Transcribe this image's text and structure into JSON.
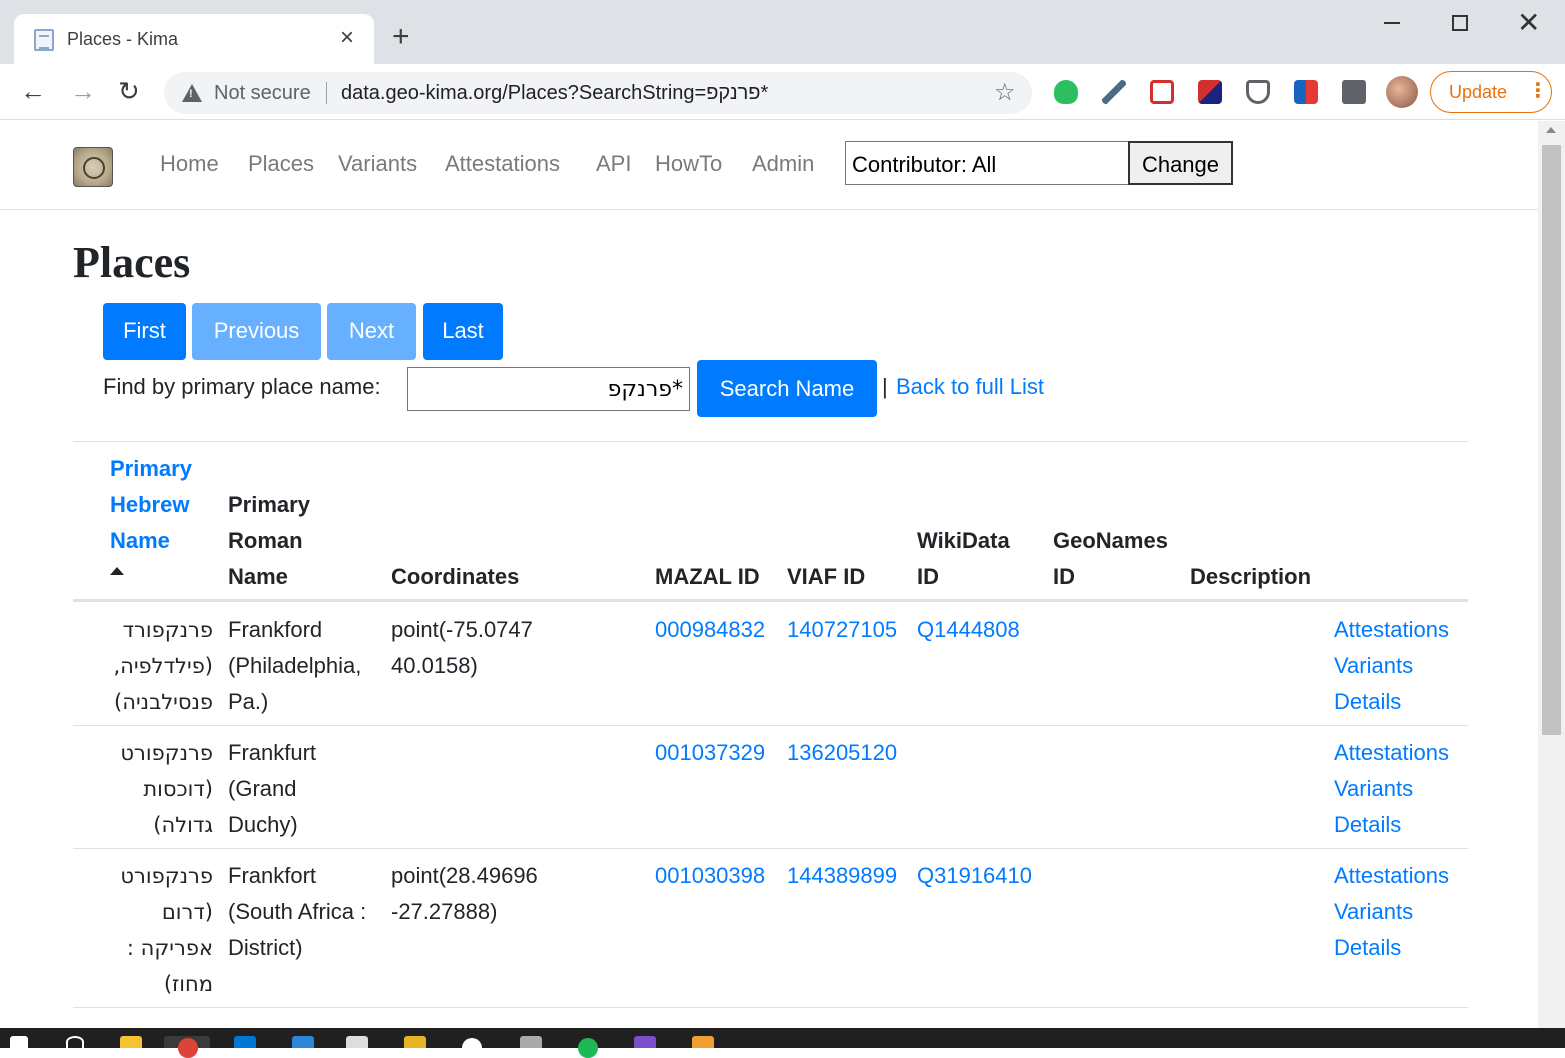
{
  "browser": {
    "tab_title": "Places - Kima",
    "new_tab": "+",
    "close_tab": "×",
    "address": {
      "security": "Not secure",
      "url": "data.geo-kima.org/Places?SearchString=פרנקפ*"
    },
    "update_label": "Update",
    "menu_dots": "⋮"
  },
  "site": {
    "nav": [
      {
        "label": "Home"
      },
      {
        "label": "Places"
      },
      {
        "label": "Variants"
      },
      {
        "label": "Attestations"
      },
      {
        "label": "API"
      },
      {
        "label": "HowTo"
      },
      {
        "label": "Admin"
      }
    ],
    "contributor_value": "Contributor: All",
    "change_label": "Change"
  },
  "main": {
    "title": "Places",
    "pagination": {
      "first": "First",
      "previous": "Previous",
      "next": "Next",
      "last": "Last"
    },
    "search": {
      "label": "Find by primary place name:",
      "value": "פרנקפ*",
      "button": "Search Name",
      "separator": "|",
      "back_link": "Back to full List"
    },
    "table": {
      "headers": {
        "hebrew": [
          "Primary",
          "Hebrew",
          "Name"
        ],
        "roman": [
          "Primary",
          "Roman",
          "Name"
        ],
        "coordinates": "Coordinates",
        "mazal": "MAZAL ID",
        "viaf": "VIAF ID",
        "wikidata": [
          "WikiData",
          "ID"
        ],
        "geonames": [
          "GeoNames",
          "ID"
        ],
        "description": "Description"
      },
      "rows": [
        {
          "hebrew": [
            "פרנקפורד",
            "(פילדלפיה,",
            "פנסילבניה)"
          ],
          "roman": [
            "Frankford",
            "(Philadelphia,",
            "Pa.)"
          ],
          "coordinates": [
            "point(-75.0747",
            "40.0158)"
          ],
          "mazal": "000984832",
          "viaf": "140727105",
          "wikidata": "Q1444808",
          "geonames": "",
          "actions": [
            "Attestations",
            "Variants",
            "Details"
          ]
        },
        {
          "hebrew": [
            "פרנקפורט",
            "(דוכסות",
            "גדולה)"
          ],
          "roman": [
            "Frankfurt",
            "(Grand",
            "Duchy)"
          ],
          "coordinates": [
            "",
            ""
          ],
          "mazal": "001037329",
          "viaf": "136205120",
          "wikidata": "",
          "geonames": "",
          "actions": [
            "Attestations",
            "Variants",
            "Details"
          ]
        },
        {
          "hebrew": [
            "פרנקפורט",
            "(דרום",
            "אפריקה :",
            "מחוז)"
          ],
          "roman": [
            "Frankfort",
            "(South Africa :",
            "District)"
          ],
          "coordinates": [
            "point(28.49696",
            "-27.27888)"
          ],
          "mazal": "001030398",
          "viaf": "144389899",
          "wikidata": "Q31916410",
          "geonames": "",
          "actions": [
            "Attestations",
            "Variants",
            "Details"
          ]
        }
      ]
    }
  }
}
